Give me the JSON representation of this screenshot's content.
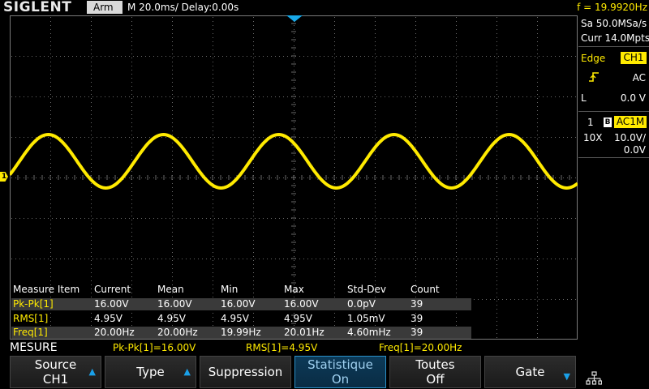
{
  "topbar": {
    "logo": "SIGLENT",
    "status": "Arm",
    "timebase": "M 20.0ms/ Delay:0.00s",
    "frequency": "f = 19.9920Hz"
  },
  "right_panel": {
    "sample_rate": "Sa 50.0MSa/s",
    "memory_depth": "Curr 14.0Mpts",
    "trigger_type": "Edge",
    "trigger_source": "CH1",
    "trigger_coupling": "AC",
    "trigger_level_label": "L",
    "trigger_level": "0.0 V",
    "channel_number": "1",
    "bandwidth_flag": "B",
    "channel_coupling": "AC1M",
    "probe": "10X",
    "volts_per_div": "10.0V/",
    "offset": "0.0V"
  },
  "waveform": {
    "channel_marker": "1",
    "color": "#ffea00"
  },
  "measure_table": {
    "headers": [
      "Measure Item",
      "Current",
      "Mean",
      "Min",
      "Max",
      "Std-Dev",
      "Count"
    ],
    "rows": [
      [
        "Pk-Pk[1]",
        "16.00V",
        "16.00V",
        "16.00V",
        "16.00V",
        "0.0pV",
        "39"
      ],
      [
        "RMS[1]",
        "4.95V",
        "4.95V",
        "4.95V",
        "4.95V",
        "1.05mV",
        "39"
      ],
      [
        "Freq[1]",
        "20.00Hz",
        "20.00Hz",
        "19.99Hz",
        "20.01Hz",
        "4.60mHz",
        "39"
      ]
    ]
  },
  "status_line": {
    "menu_title": "MESURE",
    "items": [
      "Pk-Pk[1]=16.00V",
      "RMS[1]=4.95V",
      "Freq[1]=20.00Hz"
    ]
  },
  "softkeys": [
    {
      "line1": "Source",
      "line2": "CH1",
      "arrow": true
    },
    {
      "line1": "Type",
      "line2": "",
      "arrow": true
    },
    {
      "line1": "Suppression",
      "line2": "",
      "arrow": false
    },
    {
      "line1": "Statistique",
      "line2": "On",
      "arrow": false,
      "active": true
    },
    {
      "line1": "Toutes",
      "line2": "Off",
      "arrow": false
    },
    {
      "line1": "Gate",
      "line2": "",
      "arrow": true
    }
  ],
  "colors": {
    "accent": "#ffea00",
    "trigger_marker": "#18a8e8",
    "active_key": "#0c3a58"
  }
}
